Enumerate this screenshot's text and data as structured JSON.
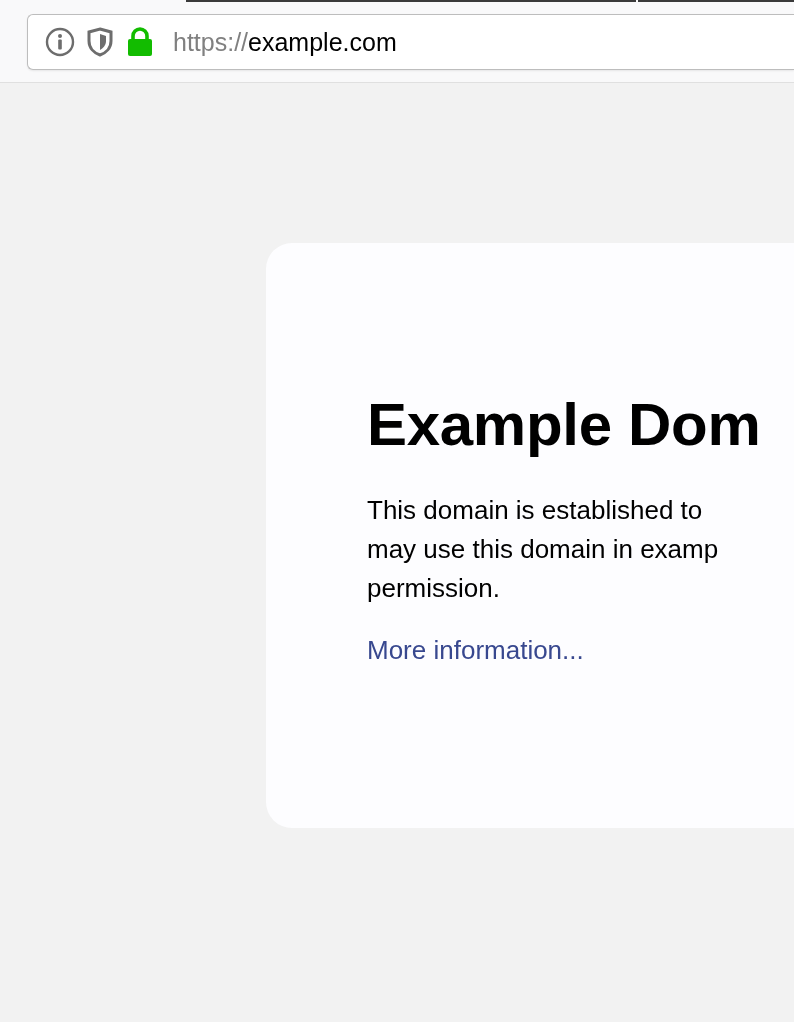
{
  "address_bar": {
    "scheme": "https://",
    "host": "example.com",
    "secure": true
  },
  "page": {
    "heading": "Example Dom",
    "paragraph_lines": [
      "This domain is established to",
      "may use this domain in examp",
      "permission."
    ],
    "link": "More information..."
  }
}
